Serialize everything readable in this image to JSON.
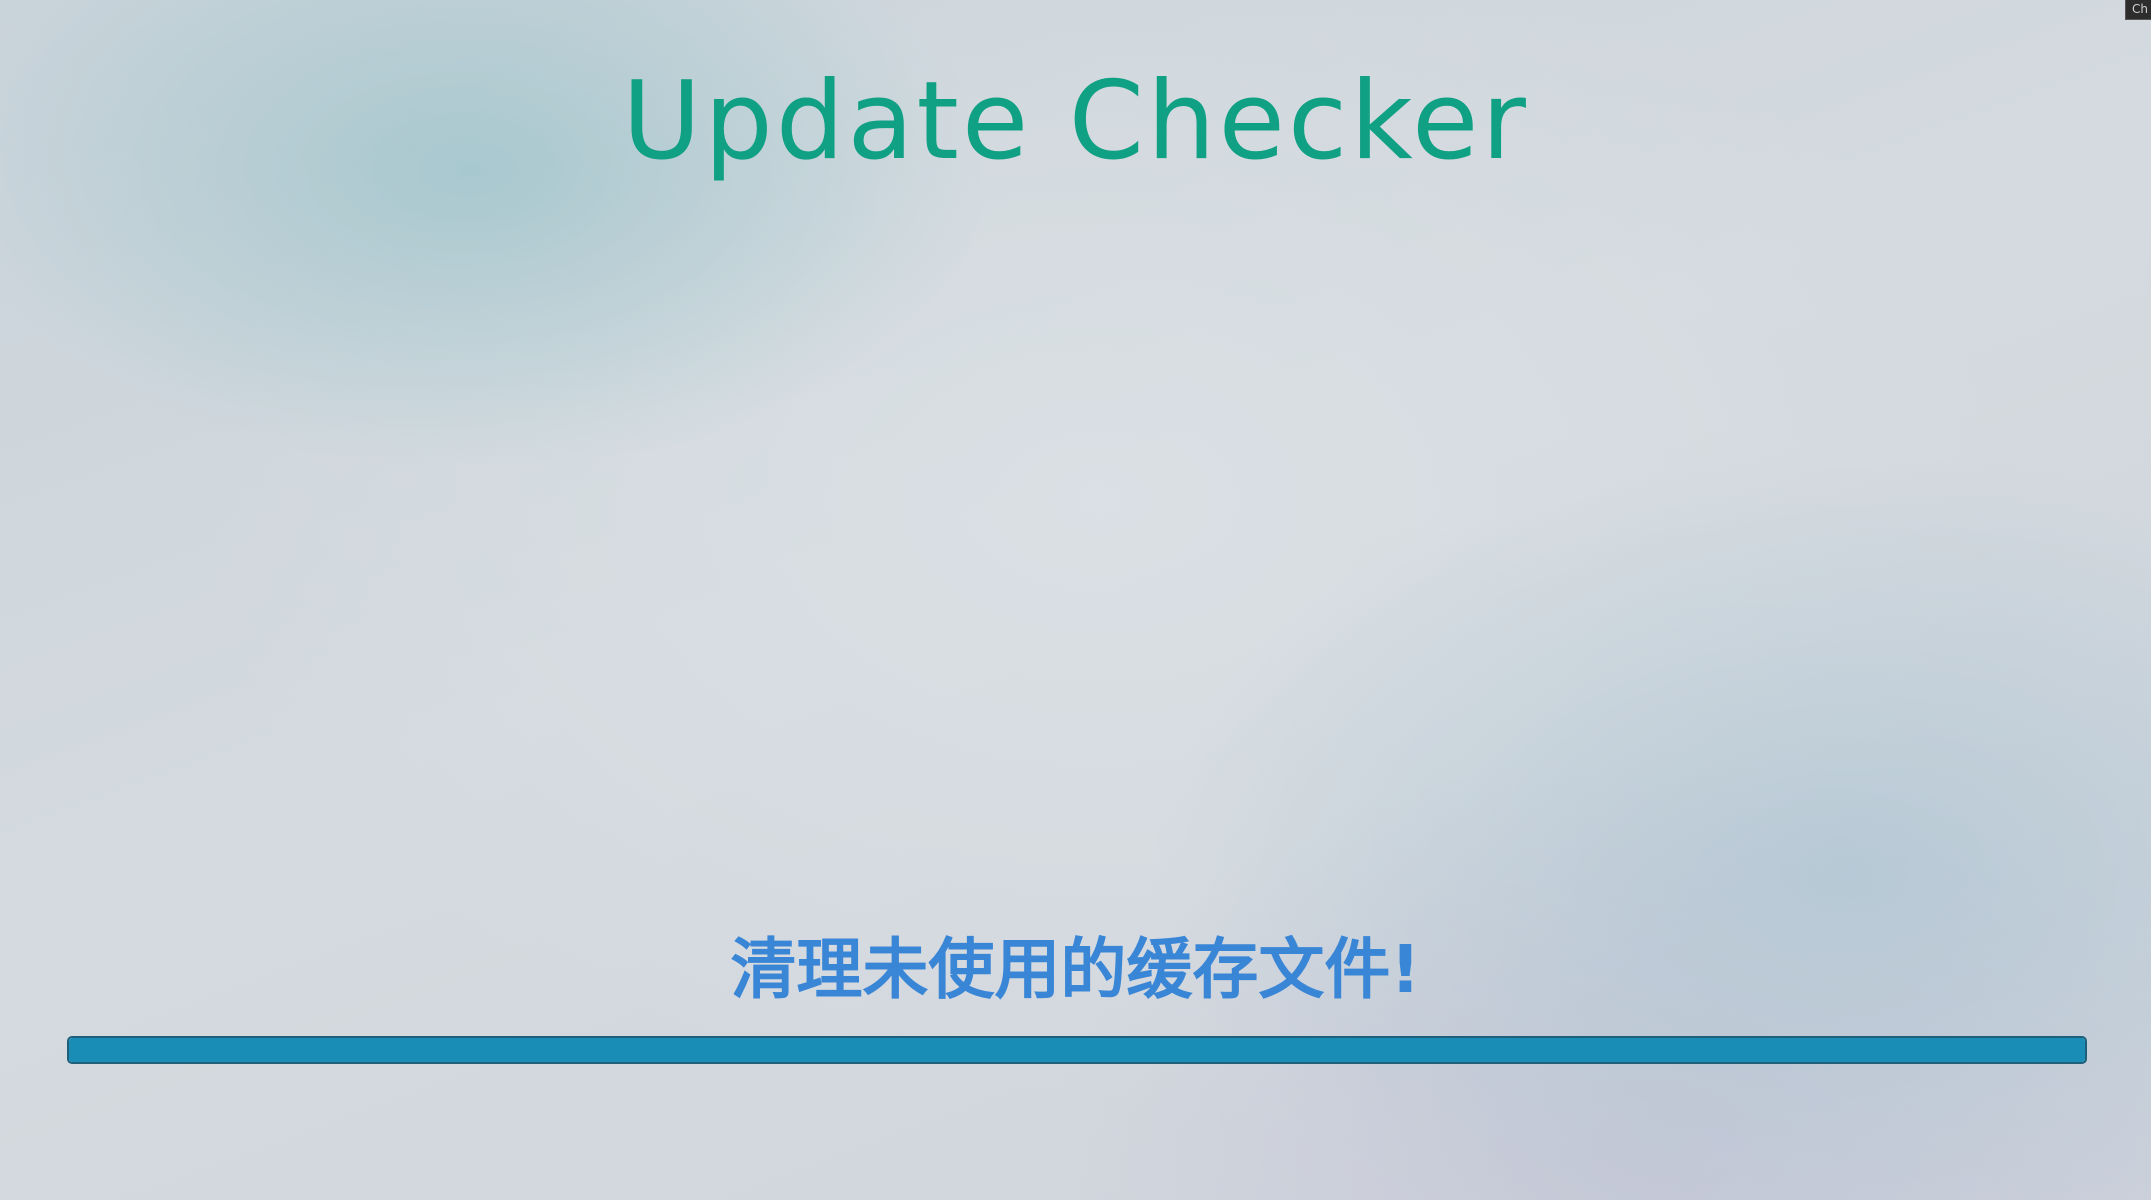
{
  "app": {
    "title": "Update Checker",
    "title_color": "#10a084"
  },
  "status": {
    "message": "清理未使用的缓存文件!",
    "message_color": "#3a86d6"
  },
  "progress": {
    "fraction": 1.0,
    "fill_color": "#1a8db6"
  },
  "corner_tag": {
    "text": "Ch"
  }
}
